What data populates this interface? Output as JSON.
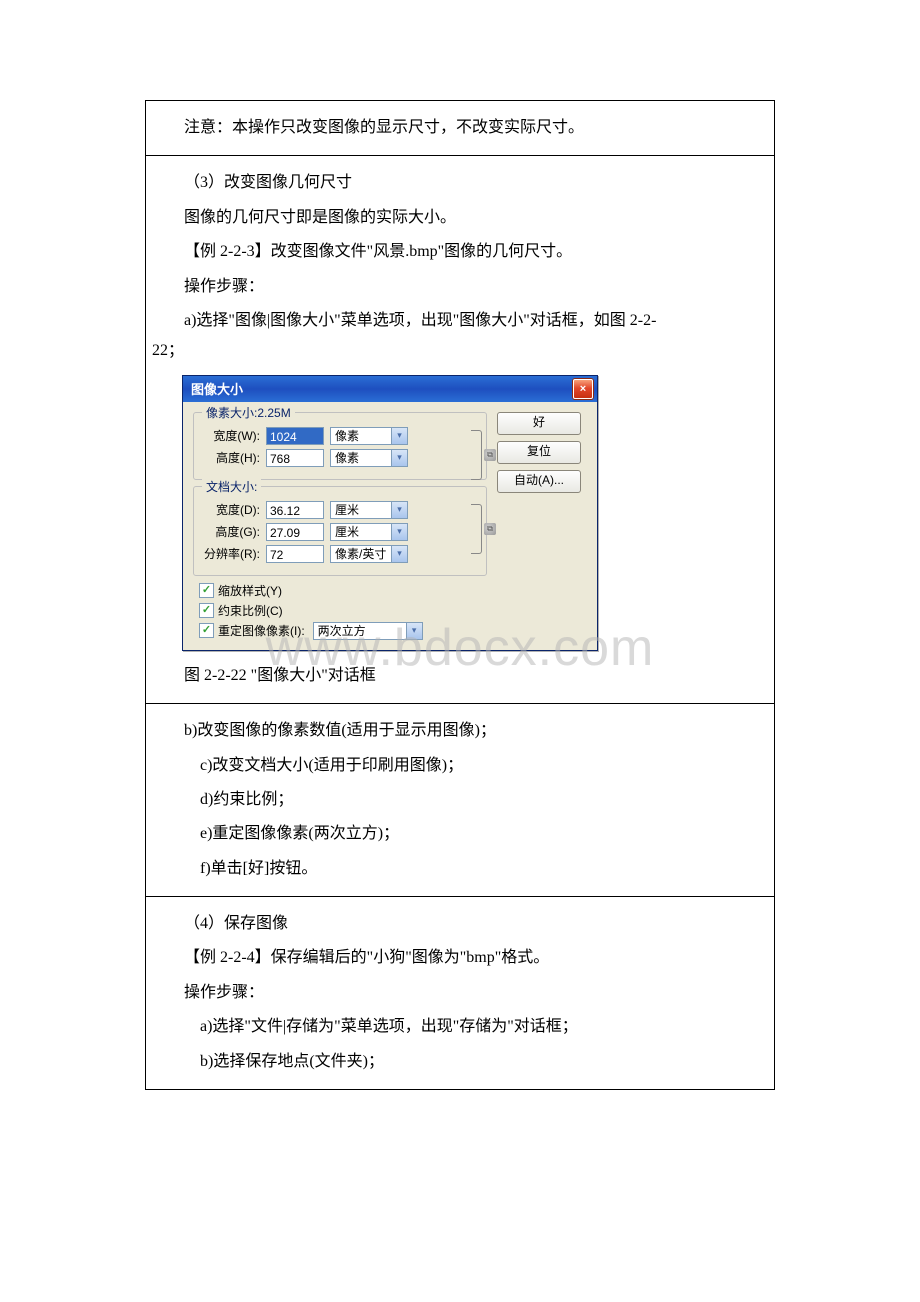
{
  "doc": {
    "cell1_p1": "注意：本操作只改变图像的显示尺寸，不改变实际尺寸。",
    "cell2_p1": "（3）改变图像几何尺寸",
    "cell2_p2": "图像的几何尺寸即是图像的实际大小。",
    "cell2_p3": "【例 2-2-3】改变图像文件\"风景.bmp\"图像的几何尺寸。",
    "cell2_p4": "操作步骤：",
    "cell2_p5a": "a)选择\"图像|图像大小\"菜单选项，出现\"图像大小\"对话框，如图 2-2-",
    "cell2_p5b": "22；",
    "caption": "图 2-2-22 \"图像大小\"对话框",
    "cell3_p1": "b)改变图像的像素数值(适用于显示用图像)；",
    "cell3_p2": "c)改变文档大小(适用于印刷用图像)；",
    "cell3_p3": "d)约束比例；",
    "cell3_p4": "e)重定图像像素(两次立方)；",
    "cell3_p5": "f)单击[好]按钮。",
    "cell4_p1": "（4）保存图像",
    "cell4_p2": "【例 2-2-4】保存编辑后的\"小狗\"图像为\"bmp\"格式。",
    "cell4_p3": "操作步骤：",
    "cell4_p4": "a)选择\"文件|存储为\"菜单选项，出现\"存储为\"对话框；",
    "cell4_p5": "b)选择保存地点(文件夹)；"
  },
  "dialog": {
    "title": "图像大小",
    "close": "×",
    "pixel_group": "像素大小:2.25M",
    "doc_group": "文档大小:",
    "width_label": "宽度(W):",
    "height_label": "高度(H):",
    "width_d_label": "宽度(D):",
    "height_g_label": "高度(G):",
    "res_label": "分辨率(R):",
    "width_val": "1024",
    "height_val": "768",
    "width_d_val": "36.12",
    "height_g_val": "27.09",
    "res_val": "72",
    "unit_px": "像素",
    "unit_cm": "厘米",
    "unit_ppi": "像素/英寸",
    "cb_scale": "缩放样式(Y)",
    "cb_constrain": "约束比例(C)",
    "cb_resample": "重定图像像素(I):",
    "resample_method": "两次立方",
    "btn_ok": "好",
    "btn_reset": "复位",
    "btn_auto": "自动(A)..."
  },
  "watermark": "www.bdocx.com"
}
